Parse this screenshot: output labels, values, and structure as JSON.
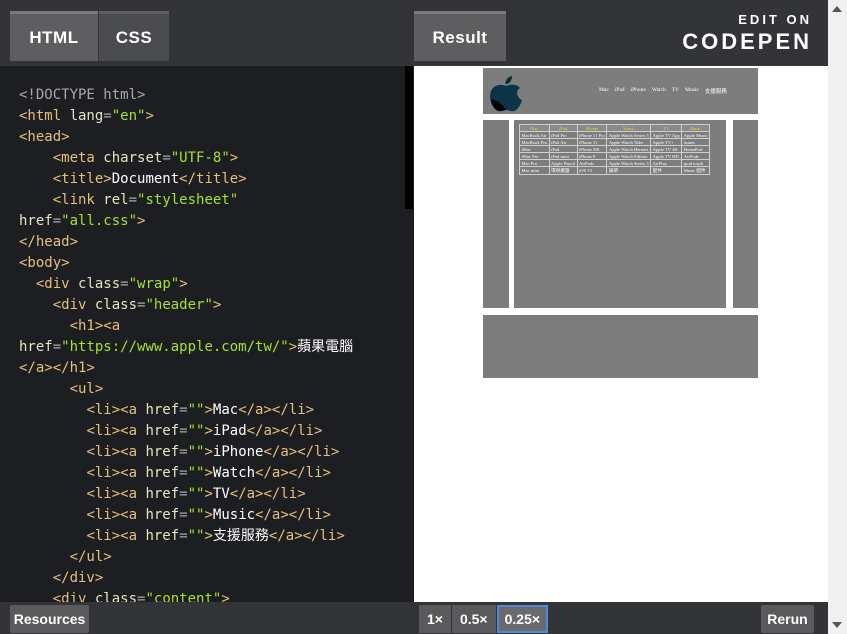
{
  "tabs": {
    "html": "HTML",
    "css": "CSS",
    "result": "Result"
  },
  "brand": {
    "top": "EDIT ON",
    "name": "CODEPEN"
  },
  "code_lines": [
    [
      [
        "t",
        "<!DOCTYPE html>"
      ]
    ],
    [
      [
        "tag",
        "<html "
      ],
      [
        "a",
        "lang"
      ],
      [
        "t",
        "="
      ],
      [
        "s",
        "\"en\""
      ],
      [
        "tag",
        ">"
      ]
    ],
    [
      [
        "tag",
        "<head>"
      ]
    ],
    [
      [
        "t",
        "    "
      ],
      [
        "tag",
        "<meta "
      ],
      [
        "a",
        "charset"
      ],
      [
        "t",
        "="
      ],
      [
        "s",
        "\"UTF-8\""
      ],
      [
        "tag",
        ">"
      ]
    ],
    [
      [
        "t",
        "    "
      ],
      [
        "tag",
        "<title>"
      ],
      [
        "tx",
        "Document"
      ],
      [
        "tag",
        "</title>"
      ]
    ],
    [
      [
        "t",
        "    "
      ],
      [
        "tag",
        "<link "
      ],
      [
        "a",
        "rel"
      ],
      [
        "t",
        "="
      ],
      [
        "s",
        "\"stylesheet\""
      ]
    ],
    [
      [
        "a",
        "href"
      ],
      [
        "t",
        "="
      ],
      [
        "s",
        "\"all.css\""
      ],
      [
        "tag",
        ">"
      ]
    ],
    [
      [
        "tag",
        "</head>"
      ]
    ],
    [
      [
        "tag",
        "<body>"
      ]
    ],
    [
      [
        "t",
        "  "
      ],
      [
        "tag",
        "<div "
      ],
      [
        "a",
        "class"
      ],
      [
        "t",
        "="
      ],
      [
        "s",
        "\"wrap\""
      ],
      [
        "tag",
        ">"
      ]
    ],
    [
      [
        "t",
        "    "
      ],
      [
        "tag",
        "<div "
      ],
      [
        "a",
        "class"
      ],
      [
        "t",
        "="
      ],
      [
        "s",
        "\"header\""
      ],
      [
        "tag",
        ">"
      ]
    ],
    [
      [
        "t",
        "      "
      ],
      [
        "tag",
        "<h1><a"
      ]
    ],
    [
      [
        "a",
        "href"
      ],
      [
        "t",
        "="
      ],
      [
        "s",
        "\"https://www.apple.com/tw/\""
      ],
      [
        "tag",
        ">"
      ],
      [
        "tx",
        "蘋果電腦"
      ]
    ],
    [
      [
        "tag",
        "</a></h1>"
      ]
    ],
    [
      [
        "t",
        "      "
      ],
      [
        "tag",
        "<ul>"
      ]
    ],
    [
      [
        "t",
        "        "
      ],
      [
        "tag",
        "<li><a "
      ],
      [
        "a",
        "href"
      ],
      [
        "t",
        "="
      ],
      [
        "s",
        "\"\""
      ],
      [
        "tag",
        ">"
      ],
      [
        "tx",
        "Mac"
      ],
      [
        "tag",
        "</a></li>"
      ]
    ],
    [
      [
        "t",
        "        "
      ],
      [
        "tag",
        "<li><a "
      ],
      [
        "a",
        "href"
      ],
      [
        "t",
        "="
      ],
      [
        "s",
        "\"\""
      ],
      [
        "tag",
        ">"
      ],
      [
        "tx",
        "iPad"
      ],
      [
        "tag",
        "</a></li>"
      ]
    ],
    [
      [
        "t",
        "        "
      ],
      [
        "tag",
        "<li><a "
      ],
      [
        "a",
        "href"
      ],
      [
        "t",
        "="
      ],
      [
        "s",
        "\"\""
      ],
      [
        "tag",
        ">"
      ],
      [
        "tx",
        "iPhone"
      ],
      [
        "tag",
        "</a></li>"
      ]
    ],
    [
      [
        "t",
        "        "
      ],
      [
        "tag",
        "<li><a "
      ],
      [
        "a",
        "href"
      ],
      [
        "t",
        "="
      ],
      [
        "s",
        "\"\""
      ],
      [
        "tag",
        ">"
      ],
      [
        "tx",
        "Watch"
      ],
      [
        "tag",
        "</a></li>"
      ]
    ],
    [
      [
        "t",
        "        "
      ],
      [
        "tag",
        "<li><a "
      ],
      [
        "a",
        "href"
      ],
      [
        "t",
        "="
      ],
      [
        "s",
        "\"\""
      ],
      [
        "tag",
        ">"
      ],
      [
        "tx",
        "TV"
      ],
      [
        "tag",
        "</a></li>"
      ]
    ],
    [
      [
        "t",
        "        "
      ],
      [
        "tag",
        "<li><a "
      ],
      [
        "a",
        "href"
      ],
      [
        "t",
        "="
      ],
      [
        "s",
        "\"\""
      ],
      [
        "tag",
        ">"
      ],
      [
        "tx",
        "Music"
      ],
      [
        "tag",
        "</a></li>"
      ]
    ],
    [
      [
        "t",
        "        "
      ],
      [
        "tag",
        "<li><a "
      ],
      [
        "a",
        "href"
      ],
      [
        "t",
        "="
      ],
      [
        "s",
        "\"\""
      ],
      [
        "tag",
        ">"
      ],
      [
        "tx",
        "支援服務"
      ],
      [
        "tag",
        "</a></li>"
      ]
    ],
    [
      [
        "t",
        "      "
      ],
      [
        "tag",
        "</ul>"
      ]
    ],
    [
      [
        "t",
        "    "
      ],
      [
        "tag",
        "</div>"
      ]
    ],
    [
      [
        "t",
        "    "
      ],
      [
        "tag",
        "<div "
      ],
      [
        "a",
        "class"
      ],
      [
        "t",
        "="
      ],
      [
        "s",
        "\"content\""
      ],
      [
        "tag",
        ">"
      ]
    ]
  ],
  "preview": {
    "nav": [
      "Mac",
      "iPad",
      "iPhone",
      "Watch",
      "TV",
      "Music",
      "支援服務"
    ],
    "table": {
      "headers": [
        "Mac",
        "iPad",
        "iPhone",
        "Watch",
        "TV",
        "Music"
      ],
      "rows": [
        [
          "MacBook Air",
          "iPad Pro",
          "iPhone 11 Pro",
          "Apple Watch Series 5",
          "Apple TV App",
          "Apple Music"
        ],
        [
          "MacBook Pro",
          "iPad Air",
          "iPhone 11",
          "Apple Watch Nike",
          "Apple TV+",
          "itunes"
        ],
        [
          "iMac",
          "iPad",
          "iPhone XR",
          "Apple Watch Hermes",
          "Apple TV 4K",
          "HomePod"
        ],
        [
          "iMac Pro",
          "iPad mini",
          "iPhone 8",
          "Apple Watch Edition",
          "Apple TV HD",
          "AirPods"
        ],
        [
          "Mac Pro",
          "Apple Pencil",
          "AirPods",
          "Apple Watch Series 3",
          "AirPlay",
          "ipod touch"
        ],
        [
          "Mac mini",
          "環保鍵盤",
          "iOS 13",
          "錶帶",
          "配件",
          "Music 配件"
        ]
      ]
    }
  },
  "bottom": {
    "resources": "Resources",
    "zooms": [
      "1×",
      "0.5×",
      "0.25×"
    ],
    "active_zoom": "0.25×",
    "rerun": "Rerun"
  }
}
